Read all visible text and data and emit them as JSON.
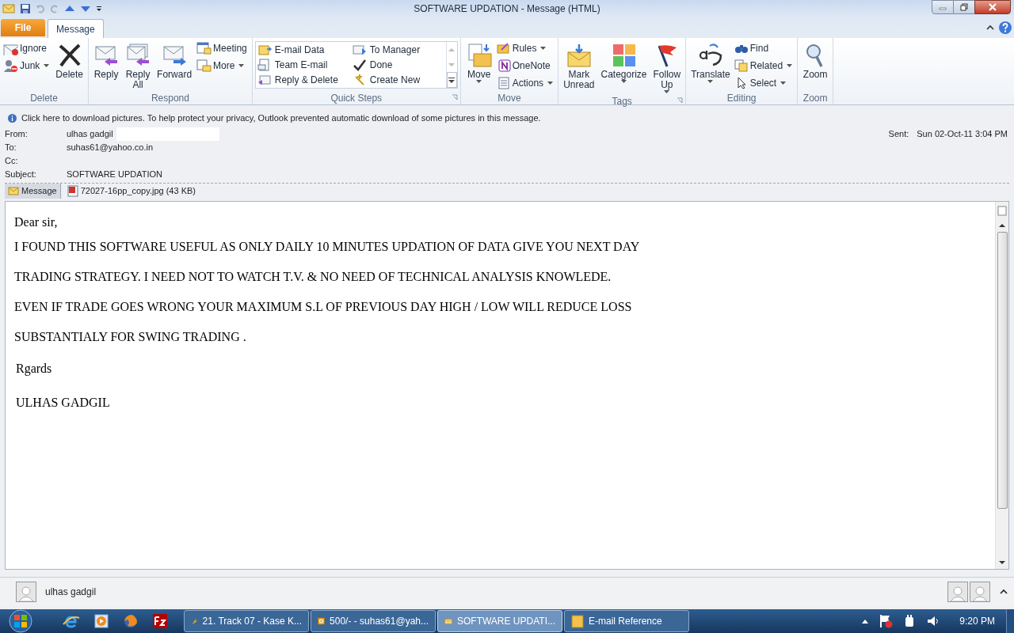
{
  "window": {
    "title": "SOFTWARE UPDATION  -  Message (HTML)"
  },
  "tabs": [
    {
      "label": "File",
      "kind": "file",
      "selected": false
    },
    {
      "label": "Message",
      "kind": "tab",
      "selected": true
    }
  ],
  "ribbon": [
    {
      "label": "Delete",
      "launcher": false,
      "items": [
        {
          "label": "Ignore",
          "kind": "small",
          "menu": false
        },
        {
          "label": "Junk",
          "kind": "small",
          "menu": true
        },
        {
          "label": "Delete",
          "kind": "large",
          "menu": false
        }
      ]
    },
    {
      "label": "Respond",
      "launcher": false,
      "items": [
        {
          "label": "Reply",
          "kind": "large",
          "menu": false
        },
        {
          "label": "Reply\nAll",
          "kind": "large",
          "menu": false
        },
        {
          "label": "Forward",
          "kind": "large",
          "menu": false
        },
        {
          "label": "Meeting",
          "kind": "small",
          "menu": false
        },
        {
          "label": "More",
          "kind": "small",
          "menu": true
        }
      ]
    },
    {
      "label": "Quick Steps",
      "launcher": true,
      "items": [
        {
          "label": "E-mail Data",
          "kind": "gallery",
          "menu": false
        },
        {
          "label": "Team E-mail",
          "kind": "gallery",
          "menu": false
        },
        {
          "label": "Reply & Delete",
          "kind": "gallery",
          "menu": false
        },
        {
          "label": "To Manager",
          "kind": "gallery",
          "menu": false
        },
        {
          "label": "Done",
          "kind": "gallery",
          "menu": false
        },
        {
          "label": "Create New",
          "kind": "gallery",
          "menu": false
        }
      ]
    },
    {
      "label": "Move",
      "launcher": false,
      "items": [
        {
          "label": "Move",
          "kind": "large",
          "menu": true
        },
        {
          "label": "Rules",
          "kind": "small",
          "menu": true
        },
        {
          "label": "OneNote",
          "kind": "small",
          "menu": false
        },
        {
          "label": "Actions",
          "kind": "small",
          "menu": true
        }
      ]
    },
    {
      "label": "Tags",
      "launcher": true,
      "items": [
        {
          "label": "Mark\nUnread",
          "kind": "large",
          "menu": false
        },
        {
          "label": "Categorize",
          "kind": "large",
          "menu": true
        },
        {
          "label": "Follow\nUp",
          "kind": "large",
          "menu": true
        }
      ]
    },
    {
      "label": "Editing",
      "launcher": false,
      "items": [
        {
          "label": "Translate",
          "kind": "large",
          "menu": true
        },
        {
          "label": "Find",
          "kind": "small",
          "menu": false
        },
        {
          "label": "Related",
          "kind": "small",
          "menu": true
        },
        {
          "label": "Select",
          "kind": "small",
          "menu": true
        }
      ]
    },
    {
      "label": "Zoom",
      "launcher": false,
      "items": [
        {
          "label": "Zoom",
          "kind": "large",
          "menu": false
        }
      ]
    }
  ],
  "info_bar": "Click here to download pictures. To help protect your privacy, Outlook prevented automatic download of some pictures in this message.",
  "header": {
    "fields": [
      {
        "label": "From:",
        "value": "ulhas gadgil",
        "redacted": true
      },
      {
        "label": "To:",
        "value": "suhas61@yahoo.co.in",
        "redacted": false
      },
      {
        "label": "Cc:",
        "redacted": false
      },
      {
        "label": "Subject:",
        "value": "SOFTWARE UPDATION",
        "redacted": false
      }
    ],
    "sent_label": "Sent:",
    "sent_value": "Sun 02-Oct-11 3:04 PM"
  },
  "attachments": [
    {
      "label": "Message",
      "kind": "message",
      "selected": true
    },
    {
      "label": "72027-16pp_copy.jpg (43 KB)",
      "kind": "image",
      "selected": false
    }
  ],
  "body": {
    "greeting": "Dear sir,",
    "paragraphs": [
      "I FOUND THIS SOFTWARE USEFUL AS ONLY DAILY 10 MINUTES UPDATION OF DATA GIVE YOU NEXT DAY",
      "TRADING STRATEGY. I NEED NOT TO WATCH T.V. & NO NEED OF TECHNICAL ANALYSIS KNOWLEDE.",
      "EVEN IF TRADE GOES WRONG YOUR MAXIMUM S.L OF PREVIOUS DAY HIGH / LOW WILL REDUCE LOSS",
      "SUBSTANTIALY FOR SWING TRADING ."
    ],
    "closing": "Rgards",
    "signature": "ULHAS GADGIL"
  },
  "people_pane": {
    "name": "ulhas gadgil"
  },
  "taskbar": {
    "tasks": [
      {
        "label": "21. Track 07 - Kase K...",
        "kind": "player",
        "selected": false
      },
      {
        "label": "500/- - suhas61@yah...",
        "kind": "outlook",
        "selected": false
      },
      {
        "label": "SOFTWARE UPDATI...",
        "kind": "mail",
        "selected": true
      },
      {
        "label": "E-mail Reference",
        "kind": "folder",
        "selected": false
      }
    ],
    "time": "9:20 PM"
  }
}
